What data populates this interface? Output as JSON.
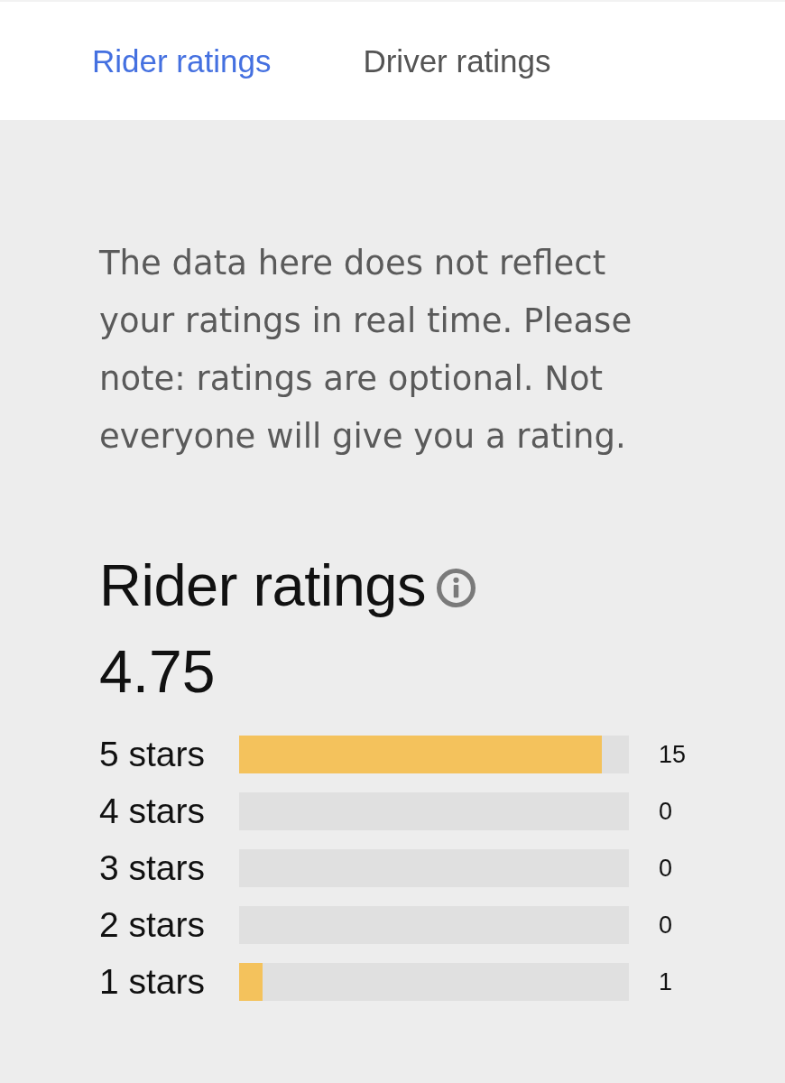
{
  "tabs": [
    {
      "label": "Rider ratings",
      "selected": true
    },
    {
      "label": "Driver ratings",
      "selected": false
    }
  ],
  "notice": {
    "text": "The data here does not reflect your ratings in real time. Please note: ratings are optional. Not everyone will give you a rating."
  },
  "ratings": {
    "title": "Rider ratings",
    "average": "4.75",
    "rows": [
      {
        "label": "5 stars",
        "level": 0.93,
        "count": "15"
      },
      {
        "label": "4 stars",
        "level": 0,
        "count": "0"
      },
      {
        "label": "3 stars",
        "level": 0,
        "count": "0"
      },
      {
        "label": "2 stars",
        "level": 0,
        "count": "0"
      },
      {
        "label": "1 stars",
        "level": 0.06,
        "count": "1"
      }
    ]
  }
}
